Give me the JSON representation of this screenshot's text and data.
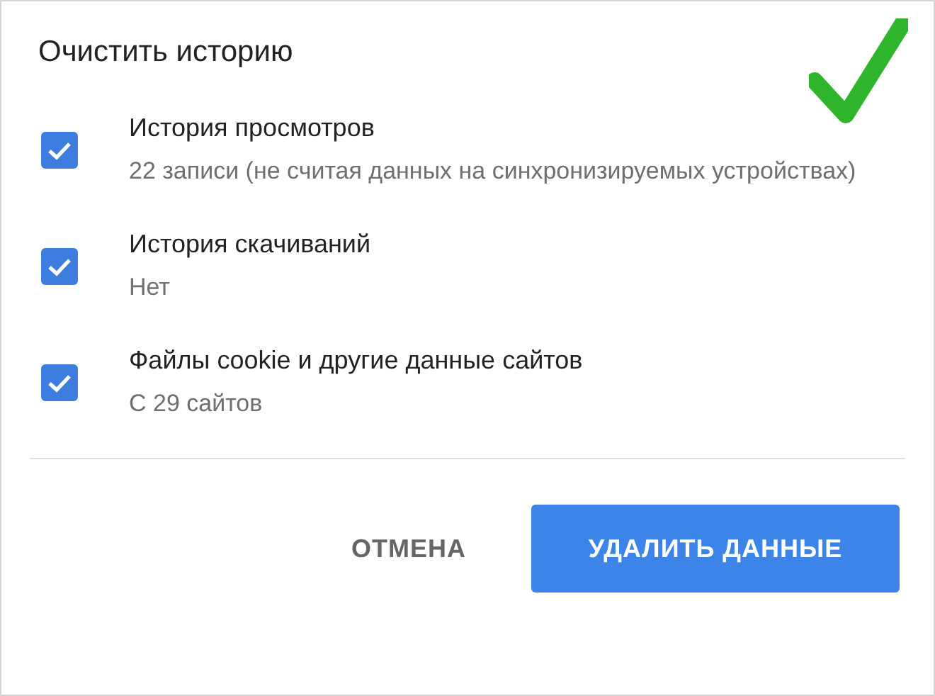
{
  "dialog": {
    "title": "Очистить историю"
  },
  "options": [
    {
      "label": "История просмотров",
      "detail": "22 записи (не считая данных на синхронизируемых устройствах)",
      "checked": true
    },
    {
      "label": "История скачиваний",
      "detail": "Нет",
      "checked": true
    },
    {
      "label": "Файлы cookie и другие данные сайтов",
      "detail": "С 29 сайтов",
      "checked": true
    }
  ],
  "buttons": [
    {
      "label": "ОТМЕНА",
      "kind": "text"
    },
    {
      "label": "УДАЛИТЬ ДАННЫЕ",
      "kind": "primary"
    }
  ]
}
